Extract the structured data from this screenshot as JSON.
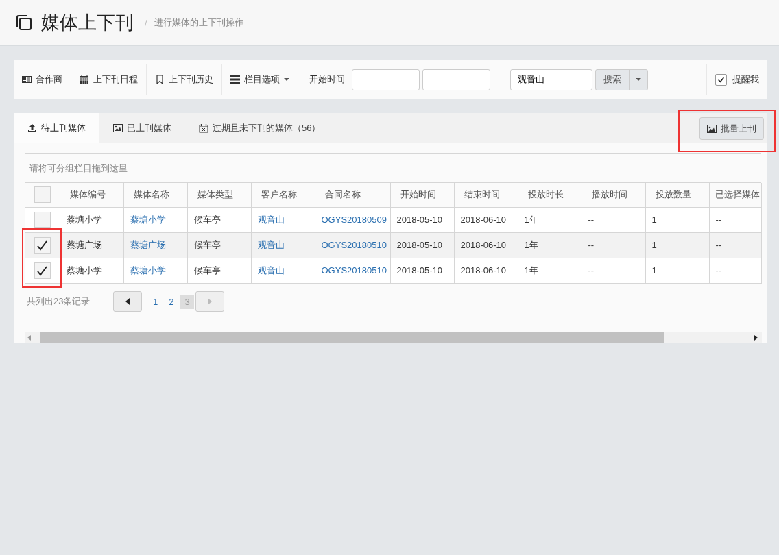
{
  "header": {
    "title": "媒体上下刊",
    "separator": "/",
    "subtitle": "进行媒体的上下刊操作"
  },
  "toolbar": {
    "items": [
      {
        "kind": "card",
        "label": "合作商"
      },
      {
        "kind": "calendar",
        "label": "上下刊日程"
      },
      {
        "kind": "bookmark",
        "label": "上下刊历史"
      },
      {
        "kind": "columns",
        "label": "栏目选项"
      }
    ],
    "start_time_label": "开始时间",
    "search_value": "观音山",
    "search_button": "搜索",
    "remind": {
      "label": "提醒我",
      "checked": true
    }
  },
  "tabs": [
    {
      "label": "待上刊媒体",
      "selected": true
    },
    {
      "label": "已上刊媒体",
      "selected": false
    },
    {
      "label": "过期且未下刊的媒体（56）",
      "selected": false
    }
  ],
  "batch_button": "批量上刊",
  "group_hint": "请将可分组栏目拖到这里",
  "table": {
    "all_checked": false,
    "columns": [
      {
        "label": "媒体编号",
        "kind": "text"
      },
      {
        "label": "媒体名称",
        "kind": "link"
      },
      {
        "label": "媒体类型",
        "kind": "text"
      },
      {
        "label": "客户名称",
        "kind": "link"
      },
      {
        "label": "合同名称",
        "kind": "link"
      },
      {
        "label": "开始时间",
        "kind": "text"
      },
      {
        "label": "结束时间",
        "kind": "text"
      },
      {
        "label": "投放时长",
        "kind": "text"
      },
      {
        "label": "播放时间",
        "kind": "text"
      },
      {
        "label": "投放数量",
        "kind": "text"
      },
      {
        "label": "已选择媒体",
        "kind": "text"
      }
    ],
    "rows": [
      {
        "checked": false,
        "cells": [
          "蔡塘小学",
          "蔡塘小学",
          "候车亭",
          "观音山",
          "OGYS20180509",
          "2018-05-10",
          "2018-06-10",
          "1年",
          "--",
          "1",
          "--"
        ]
      },
      {
        "checked": true,
        "cells": [
          "蔡塘广场",
          "蔡塘广场",
          "候车亭",
          "观音山",
          "OGYS20180510",
          "2018-05-10",
          "2018-06-10",
          "1年",
          "--",
          "1",
          "--"
        ]
      },
      {
        "checked": true,
        "cells": [
          "蔡塘小学",
          "蔡塘小学",
          "候车亭",
          "观音山",
          "OGYS20180510",
          "2018-05-10",
          "2018-06-10",
          "1年",
          "--",
          "1",
          "--"
        ]
      }
    ]
  },
  "pagination": {
    "summary": "共列出23条记录",
    "pages": [
      {
        "label": "1",
        "selected": false
      },
      {
        "label": "2",
        "selected": false
      },
      {
        "label": "3",
        "selected": true
      }
    ]
  }
}
